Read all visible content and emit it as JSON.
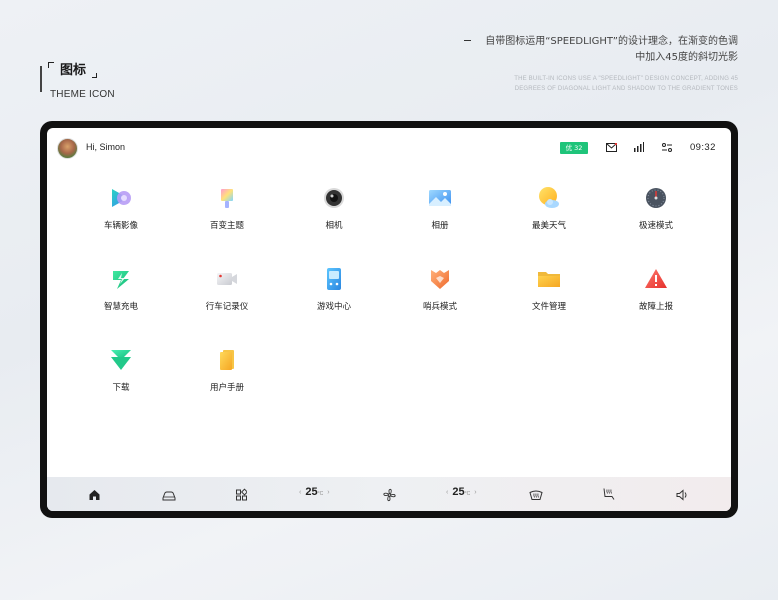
{
  "header": {
    "title": "图标",
    "subtitle": "THEME ICON",
    "description_line1": "自带图标运用“SPEEDLIGHT”的设计理念，在渐变的色调",
    "description_line2": "中加入45度的斜切光影",
    "english_description_line1": "THE BUILT-IN ICONS USE A \"SPEEDLIGHT\" DESIGN CONCEPT, ADDING 45",
    "english_description_line2": "DEGREES OF DIAGONAL LIGHT AND SHADOW TO THE GRADIENT TONES"
  },
  "status_bar": {
    "greeting": "Hi, Simon",
    "air_quality": "优 32",
    "icons": [
      "mail-icon",
      "signal-icon",
      "settings-toggle-icon"
    ],
    "time": "09:32"
  },
  "apps": [
    {
      "label": "车辆影像",
      "icon": "vehicle-camera-icon"
    },
    {
      "label": "百变主题",
      "icon": "theme-icon"
    },
    {
      "label": "相机",
      "icon": "camera-icon"
    },
    {
      "label": "相册",
      "icon": "gallery-icon"
    },
    {
      "label": "最美天气",
      "icon": "weather-icon"
    },
    {
      "label": "极速模式",
      "icon": "speed-mode-icon"
    },
    {
      "label": "智慧充电",
      "icon": "charging-icon"
    },
    {
      "label": "行车记录仪",
      "icon": "dashcam-icon"
    },
    {
      "label": "游戏中心",
      "icon": "game-center-icon"
    },
    {
      "label": "哨兵模式",
      "icon": "sentry-mode-icon"
    },
    {
      "label": "文件管理",
      "icon": "file-manager-icon"
    },
    {
      "label": "故障上报",
      "icon": "fault-report-icon"
    },
    {
      "label": "下载",
      "icon": "download-icon"
    },
    {
      "label": "用户手册",
      "icon": "user-manual-icon"
    }
  ],
  "dock": {
    "items": [
      "home-icon",
      "car-icon",
      "apps-icon",
      "fan-icon",
      "defrost-icon",
      "seat-heat-icon",
      "volume-icon"
    ],
    "left_temp": "25",
    "right_temp": "25",
    "temp_unit": "°C",
    "arrow_left": "‹",
    "arrow_right": "›"
  },
  "colors": {
    "aq_badge": "#1fc47a",
    "device_frame": "#111111",
    "screen_bg": "#ffffff"
  }
}
